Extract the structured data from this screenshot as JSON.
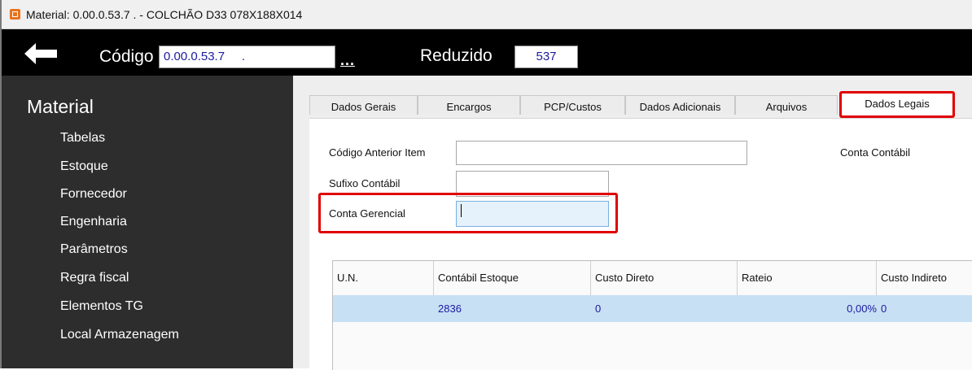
{
  "window": {
    "title": "Material: 0.00.0.53.7    . - COLCHÃO D33 078X188X014",
    "icon": "app-icon"
  },
  "toolbar": {
    "back_icon": "arrow-left-icon",
    "codigo_label": "Código",
    "codigo_value": "0.00.0.53.7     .",
    "dots_label": "...",
    "reduzido_label": "Reduzido",
    "reduzido_value": "537"
  },
  "sidebar": {
    "title": "Material",
    "items": [
      {
        "label": "Tabelas"
      },
      {
        "label": "Estoque"
      },
      {
        "label": "Fornecedor"
      },
      {
        "label": "Engenharia"
      },
      {
        "label": "Parâmetros"
      },
      {
        "label": "Regra fiscal"
      },
      {
        "label": "Elementos TG"
      },
      {
        "label": "Local Armazenagem"
      }
    ]
  },
  "tabs": [
    {
      "label": "Dados Gerais"
    },
    {
      "label": "Encargos"
    },
    {
      "label": "PCP/Custos"
    },
    {
      "label": "Dados Adicionais"
    },
    {
      "label": "Arquivos"
    },
    {
      "label": "Dados Legais",
      "active": true
    }
  ],
  "form": {
    "codigo_anterior_label": "Código Anterior Item",
    "codigo_anterior_value": "",
    "sufixo_label": "Sufixo Contábil",
    "sufixo_value": "",
    "conta_gerencial_label": "Conta Gerencial",
    "conta_gerencial_value": "",
    "conta_contabil_label": "Conta Contábil"
  },
  "grid": {
    "columns": [
      "U.N.",
      "Contábil Estoque",
      "Custo Direto",
      "Rateio",
      "Custo Indireto"
    ],
    "rows": [
      {
        "un": "",
        "contabil_estoque": "2836",
        "custo_direto": "0",
        "rateio": "0,00%",
        "custo_indireto": "0"
      }
    ]
  },
  "colors": {
    "highlight": "#e00000",
    "selected_row": "#c7e0f4",
    "sidebar_bg": "#2d2d2d",
    "toolbar_bg": "#000000"
  }
}
